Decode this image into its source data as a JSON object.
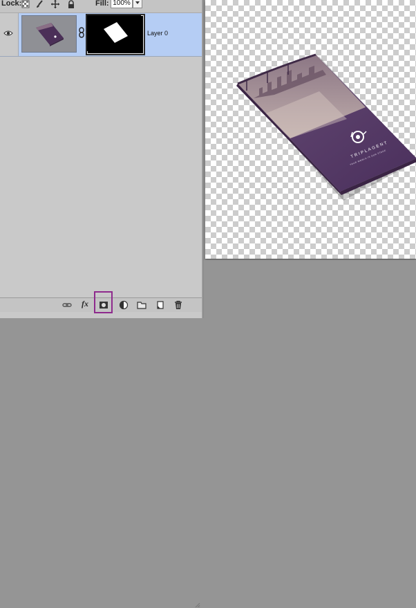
{
  "lock_row": {
    "lock_label": "Lock:",
    "fill_label": "Fill:",
    "fill_value": "100%"
  },
  "layer": {
    "name": "Layer 0"
  },
  "toolbar": {
    "fx_label": "fx"
  },
  "mockup": {
    "brand_name": "TRIPLAGENT",
    "tagline": "YOUR WORLD IS OUR STAGE"
  },
  "colors": {
    "selection": "#b5cdf4",
    "panel": "#c9c9c9",
    "highlight": "#8e2a8d",
    "brochure": "#5a3f6a"
  }
}
